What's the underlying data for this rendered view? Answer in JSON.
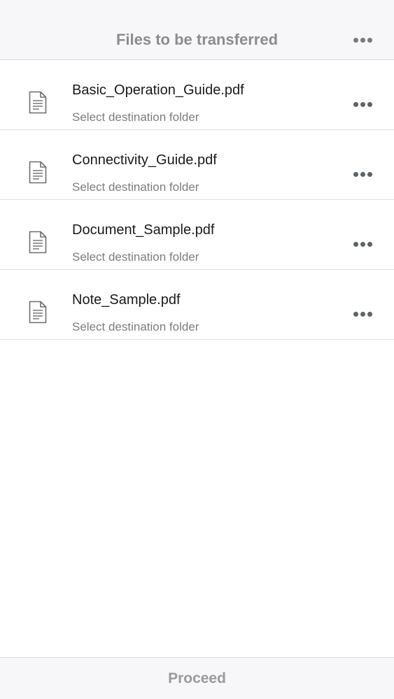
{
  "header": {
    "title": "Files to be transferred",
    "more_icon": "more-horizontal-icon"
  },
  "files": [
    {
      "name": "Basic_Operation_Guide.pdf",
      "subtitle": "Select destination folder",
      "icon": "document-icon"
    },
    {
      "name": "Connectivity_Guide.pdf",
      "subtitle": "Select destination folder",
      "icon": "document-icon"
    },
    {
      "name": "Document_Sample.pdf",
      "subtitle": "Select destination folder",
      "icon": "document-icon"
    },
    {
      "name": "Note_Sample.pdf",
      "subtitle": "Select destination folder",
      "icon": "document-icon"
    }
  ],
  "footer": {
    "proceed_label": "Proceed"
  },
  "colors": {
    "bar_background": "#f7f6f8",
    "title_text": "#8c8c8c",
    "file_name_text": "#1a1a1a",
    "subtitle_text": "#7d7d7d",
    "divider": "#e1e1e1"
  }
}
